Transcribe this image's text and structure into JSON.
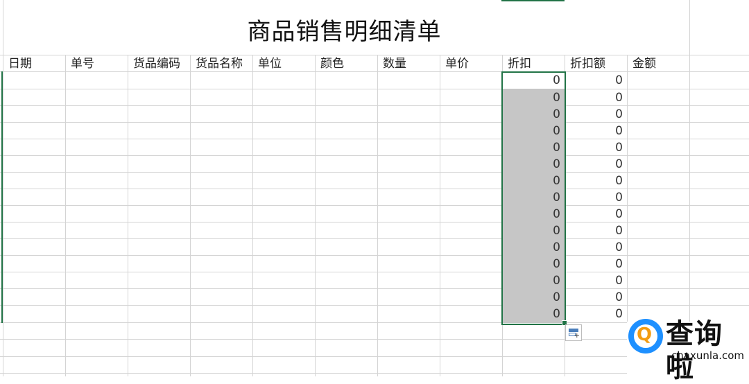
{
  "sheet": {
    "title": "商品销售明细清单",
    "headers": [
      "日期",
      "单号",
      "货品编码",
      "货品名称",
      "单位",
      "颜色",
      "数量",
      "单价",
      "折扣",
      "折扣额",
      "金额"
    ],
    "discount_values": [
      "0",
      "0",
      "0",
      "0",
      "0",
      "0",
      "0",
      "0",
      "0",
      "0",
      "0",
      "0",
      "0",
      "0",
      "0"
    ],
    "discount_amount_values": [
      "0",
      "0",
      "0",
      "0",
      "0",
      "0",
      "0",
      "0",
      "0",
      "0",
      "0",
      "0",
      "0",
      "0",
      "0"
    ],
    "selection_color": "#c6c6c6",
    "accent_color": "#217346"
  },
  "quick_analysis": {
    "icon": "quick-analysis-icon",
    "plus": "+"
  },
  "watermark": {
    "logo_letter": "Q",
    "text": "查询啦",
    "url": "chaxunla.com",
    "logo_color": "#1e90ff"
  }
}
